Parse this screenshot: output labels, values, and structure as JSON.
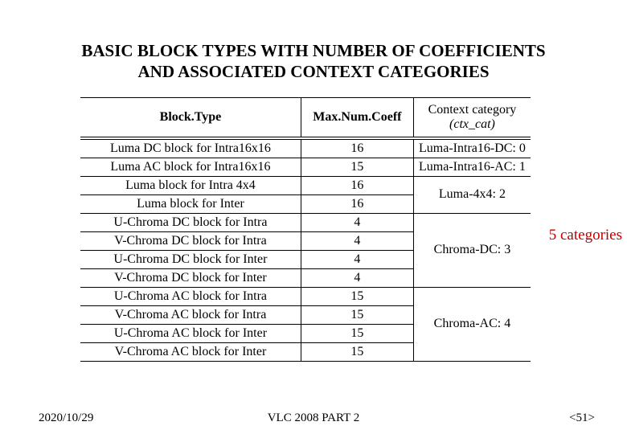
{
  "title": "BASIC BLOCK TYPES WITH NUMBER OF COEFFICIENTS AND ASSOCIATED CONTEXT CATEGORIES",
  "headers": {
    "block_type": "Block.Type",
    "max_num_coeff": "Max.Num.Coeff",
    "ctx_label": "Context category",
    "ctx_paren": "(ctx_cat)"
  },
  "groups": [
    {
      "rows": [
        {
          "block_type": "Luma DC block for Intra16x16",
          "coeff": "16"
        }
      ],
      "ctx": "Luma-Intra16-DC: 0"
    },
    {
      "rows": [
        {
          "block_type": "Luma AC block for Intra16x16",
          "coeff": "15"
        }
      ],
      "ctx": "Luma-Intra16-AC: 1"
    },
    {
      "rows": [
        {
          "block_type": "Luma block for Intra 4x4",
          "coeff": "16"
        },
        {
          "block_type": "Luma block for Inter",
          "coeff": "16"
        }
      ],
      "ctx": "Luma-4x4: 2"
    },
    {
      "rows": [
        {
          "block_type": "U-Chroma DC block for Intra",
          "coeff": "4"
        },
        {
          "block_type": "V-Chroma DC block for Intra",
          "coeff": "4"
        },
        {
          "block_type": "U-Chroma DC block for Inter",
          "coeff": "4"
        },
        {
          "block_type": "V-Chroma DC block for Inter",
          "coeff": "4"
        }
      ],
      "ctx": "Chroma-DC: 3"
    },
    {
      "rows": [
        {
          "block_type": "U-Chroma AC block for Intra",
          "coeff": "15"
        },
        {
          "block_type": "V-Chroma AC block for Intra",
          "coeff": "15"
        },
        {
          "block_type": "U-Chroma AC block for Inter",
          "coeff": "15"
        },
        {
          "block_type": "V-Chroma AC block for Inter",
          "coeff": "15"
        }
      ],
      "ctx": "Chroma-AC: 4"
    }
  ],
  "annotation": "5 categories",
  "footer": {
    "date": "2020/10/29",
    "center": "VLC 2008 PART 2",
    "page": "<51>"
  }
}
